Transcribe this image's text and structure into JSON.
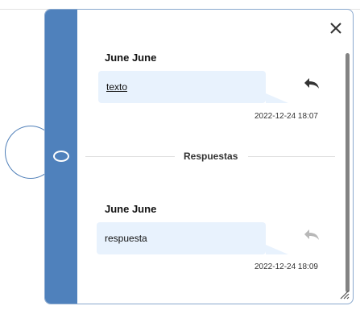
{
  "colors": {
    "rail": "#4f81bc",
    "bubble": "#e8f2fd",
    "border": "#8aa9cf",
    "replyActive": "#333333",
    "replyInactive": "#b8b8b8"
  },
  "icons": {
    "close": "close-icon",
    "reply": "reply-icon",
    "resize": "resize-handle-icon",
    "node": "circle-node-icon"
  },
  "comment": {
    "author": "June June",
    "text": "texto",
    "timestamp": "2022-12-24 18:07"
  },
  "section": {
    "title": "Respuestas"
  },
  "reply": {
    "author": "June June",
    "text": "respuesta",
    "timestamp": "2022-12-24 18:09"
  }
}
